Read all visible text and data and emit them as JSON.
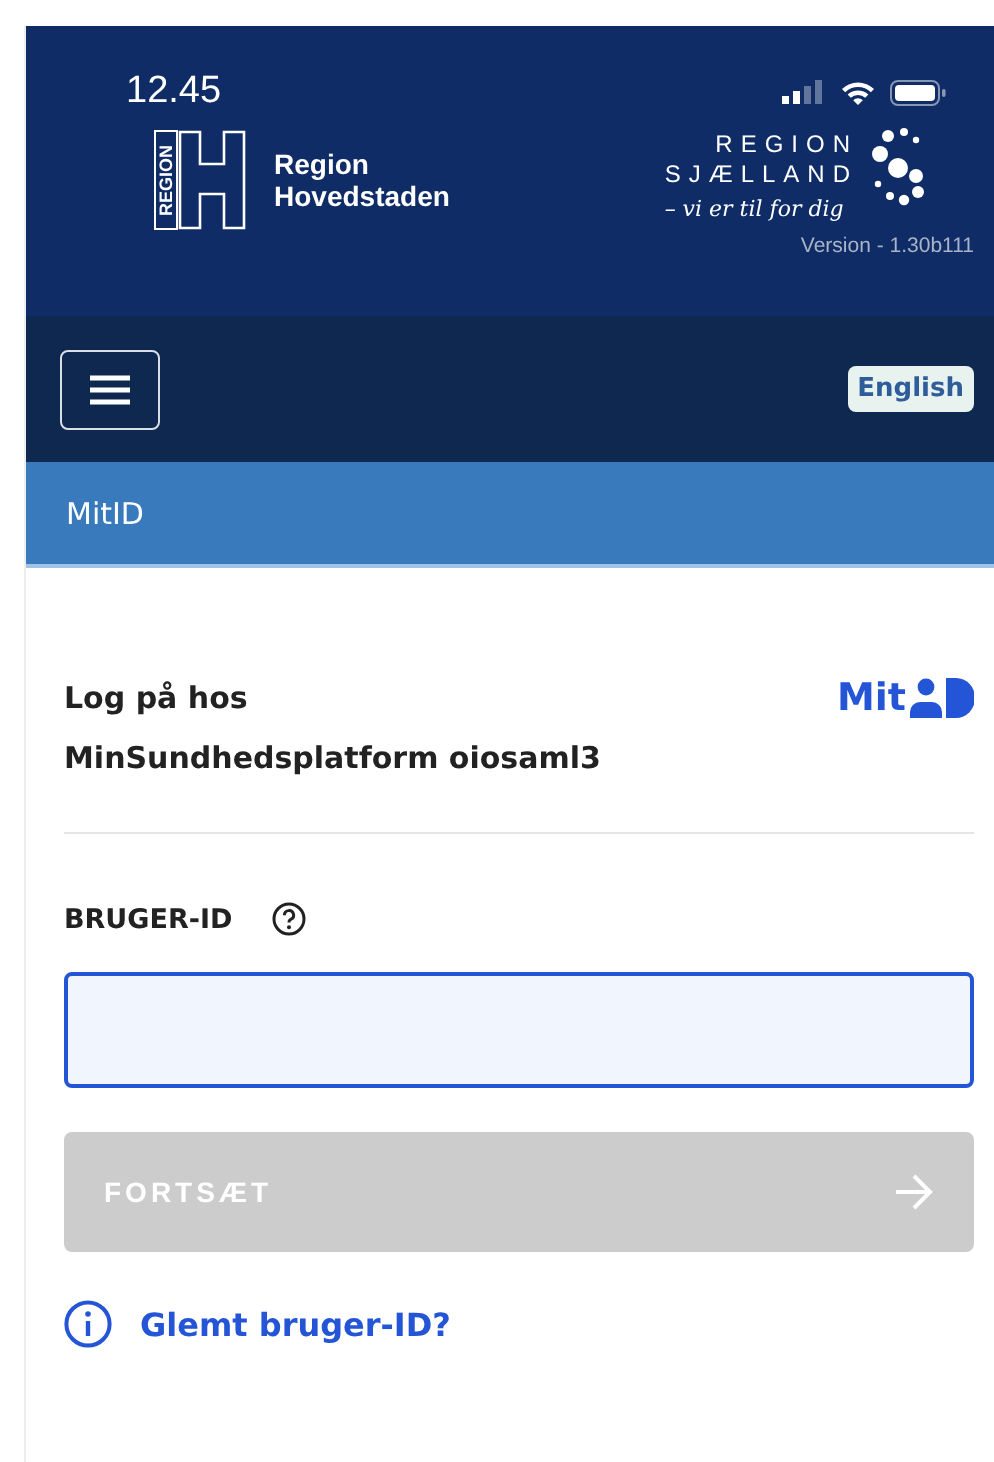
{
  "status_bar": {
    "time": "12.45"
  },
  "header": {
    "logo_left": {
      "mark": "REGION",
      "name": "Region Hovedstaden"
    },
    "logo_right": {
      "line1": "REGION",
      "line2": "SJÆLLAND",
      "tagline": "– vi er til for dig"
    },
    "version": "Version - 1.30b111"
  },
  "nav": {
    "language_button": "English"
  },
  "section_bar": {
    "title": "MitID"
  },
  "login": {
    "heading_line1": "Log på hos",
    "heading_line2": "MinSundhedsplatform oiosaml3",
    "brand": "Mit",
    "field": {
      "label": "BRUGER-ID",
      "focused": true
    },
    "continue_button": {
      "label": "FORTSÆT",
      "disabled": true
    },
    "help_link": "Glemt bruger-ID?"
  }
}
